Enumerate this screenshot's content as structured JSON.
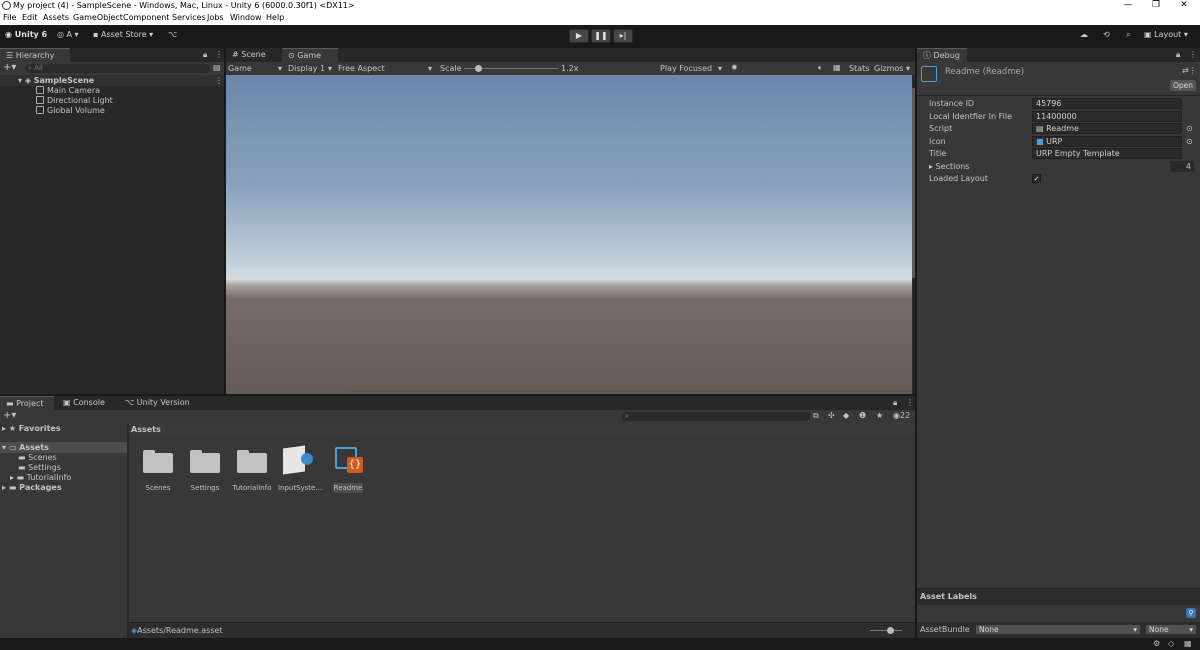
{
  "window": {
    "title": "My project (4) - SampleScene - Windows, Mac, Linux - Unity 6 (6000.0.30f1) <DX11>",
    "minimize": "—",
    "restore": "❐",
    "close": "✕"
  },
  "menu": [
    "File",
    "Edit",
    "Assets",
    "GameObject",
    "Component",
    "Services",
    "Jobs",
    "Window",
    "Help"
  ],
  "toolbar": {
    "unity": "Unity 6",
    "account": "A",
    "asset_store": "Asset Store",
    "layout": "Layout"
  },
  "hierarchy": {
    "tab": "Hierarchy",
    "search_placeholder": "All",
    "scene": "SampleScene",
    "items": [
      "Main Camera",
      "Directional Light",
      "Global Volume"
    ]
  },
  "center": {
    "tabs": [
      "Scene",
      "Game"
    ],
    "game_label": "Game",
    "display": "Display 1",
    "aspect": "Free Aspect",
    "scale_label": "Scale",
    "scale_value": "1.2x",
    "play_mode": "Play Focused",
    "stats": "Stats",
    "gizmos": "Gizmos"
  },
  "debug": {
    "tab": "Debug",
    "header": "Readme (Readme)",
    "open": "Open",
    "fields": [
      {
        "label": "Instance ID",
        "value": "45796"
      },
      {
        "label": "Local Identfier In File",
        "value": "11400000"
      },
      {
        "label": "Script",
        "value": "Readme"
      },
      {
        "label": "Icon",
        "value": "URP"
      },
      {
        "label": "Title",
        "value": "URP Empty Template"
      }
    ],
    "sections_label": "Sections",
    "sections_value": "4",
    "loaded_layout": "Loaded Layout",
    "asset_labels": "Asset Labels",
    "asset_bundle": "AssetBundle",
    "bundle_value": "None",
    "variant_value": "None"
  },
  "project": {
    "tabs": [
      "Project",
      "Console",
      "Unity Version Control"
    ],
    "badge": "22",
    "tree": {
      "favorites": "Favorites",
      "assets": "Assets",
      "children": [
        "Scenes",
        "Settings",
        "TutorialInfo"
      ],
      "packages": "Packages"
    },
    "breadcrumb": "Assets",
    "items": [
      "Scenes",
      "Settings",
      "TutorialInfo",
      "InputSyste...",
      "Readme"
    ],
    "status_path": "Assets/Readme.asset"
  },
  "game_view": {
    "sky_top": "#6b87ab",
    "sky_horizon": "#d5dde2",
    "ground": "#655a55"
  }
}
